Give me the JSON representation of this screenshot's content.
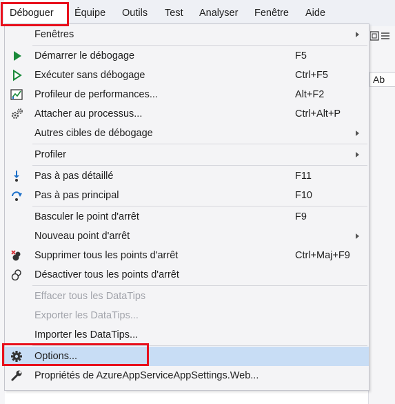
{
  "menubar": {
    "items": [
      {
        "label": "Déboguer",
        "active": true
      },
      {
        "label": "Équipe"
      },
      {
        "label": "Outils"
      },
      {
        "label": "Test"
      },
      {
        "label": "Analyser"
      },
      {
        "label": "Fenêtre"
      },
      {
        "label": "Aide"
      }
    ]
  },
  "background": {
    "tab_label": "Ab"
  },
  "menu": {
    "items": [
      {
        "label": "Fenêtres",
        "submenu": true
      },
      {
        "label": "Démarrer le débogage",
        "shortcut": "F5",
        "icon": "play-icon"
      },
      {
        "label": "Exécuter sans débogage",
        "shortcut": "Ctrl+F5",
        "icon": "play-outline-icon"
      },
      {
        "label": "Profileur de performances...",
        "shortcut": "Alt+F2",
        "icon": "performance-chart-icon"
      },
      {
        "label": "Attacher au processus...",
        "shortcut": "Ctrl+Alt+P",
        "icon": "attach-gears-icon"
      },
      {
        "label": "Autres cibles de débogage",
        "submenu": true
      },
      {
        "label": "Profiler",
        "submenu": true
      },
      {
        "label": "Pas à pas détaillé",
        "shortcut": "F11",
        "icon": "step-into-icon"
      },
      {
        "label": "Pas à pas principal",
        "shortcut": "F10",
        "icon": "step-over-icon"
      },
      {
        "label": "Basculer le point d'arrêt",
        "shortcut": "F9"
      },
      {
        "label": "Nouveau point d'arrêt",
        "submenu": true
      },
      {
        "label": "Supprimer tous les points d'arrêt",
        "shortcut": "Ctrl+Maj+F9",
        "icon": "delete-breakpoints-icon"
      },
      {
        "label": "Désactiver tous les points d'arrêt",
        "icon": "disable-breakpoints-icon"
      },
      {
        "label": "Effacer tous les DataTips",
        "disabled": true
      },
      {
        "label": "Exporter les DataTips...",
        "disabled": true
      },
      {
        "label": "Importer les DataTips..."
      },
      {
        "label": "Options...",
        "icon": "gear-icon",
        "highlighted": true
      },
      {
        "label": "Propriétés de AzureAppServiceAppSettings.Web...",
        "icon": "wrench-icon"
      }
    ]
  },
  "colors": {
    "accent_highlight": "#c8ddf5",
    "annotation": "#e8101c",
    "play_green": "#1a8a3a",
    "step_blue": "#1b6fc9"
  }
}
